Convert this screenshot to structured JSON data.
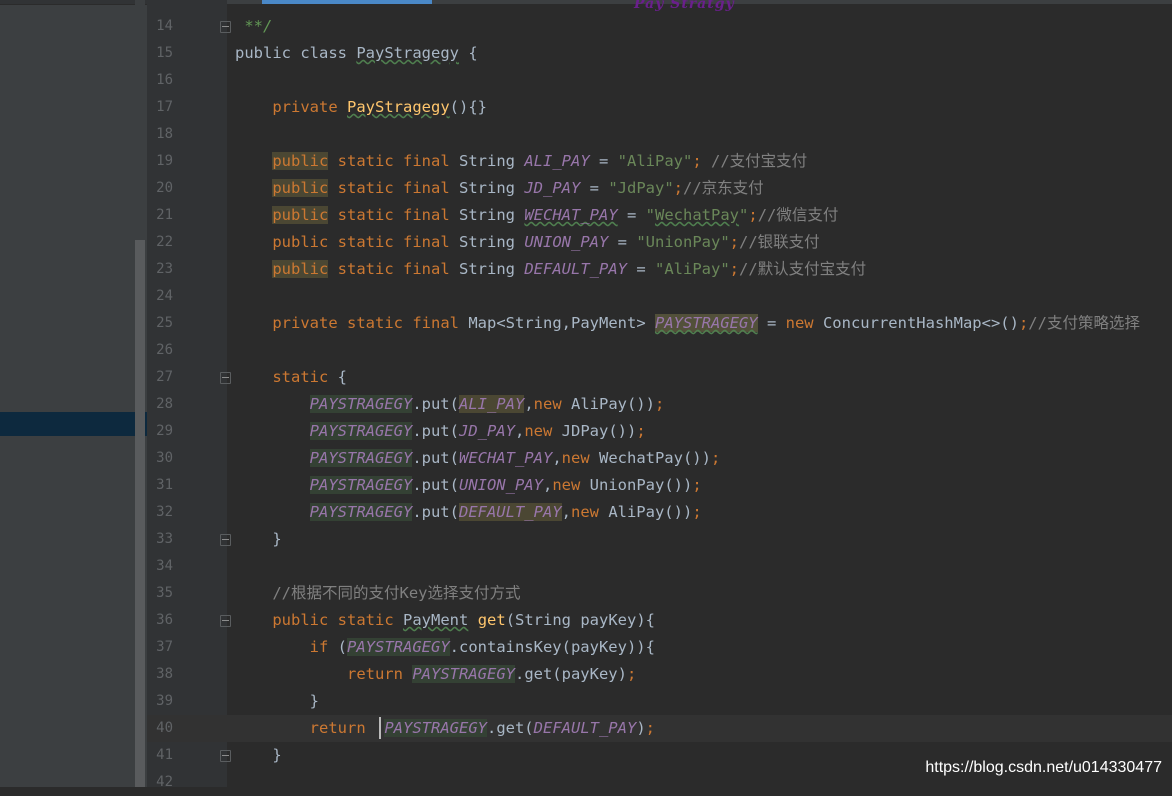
{
  "watermark": "https://blog.csdn.net/u014330477",
  "logo_text": "Pay Stratgy",
  "lines": [
    {
      "num": "14",
      "fold": true,
      "html": "<span class=\"doc\"> **/</span>"
    },
    {
      "num": "15",
      "html": "public class <span class=\"wv\">PayStragegy</span> {"
    },
    {
      "num": "16",
      "html": ""
    },
    {
      "num": "17",
      "html": "    <span class=\"kw\">private</span> <span class=\"fn wv\">PayStragegy</span>(){}"
    },
    {
      "num": "18",
      "html": ""
    },
    {
      "num": "19",
      "html": "    <span class=\"kw hl\">public</span> <span class=\"kw\">static</span> <span class=\"kw\">final</span> String <span class=\"cst\">ALI_PAY</span> = <span class=\"st\">\"AliPay\"</span><span class=\"kw\">;</span> <span class=\"cm\">//支付宝支付</span>"
    },
    {
      "num": "20",
      "html": "    <span class=\"kw hl\">public</span> <span class=\"kw\">static</span> <span class=\"kw\">final</span> String <span class=\"cst\">JD_PAY</span> = <span class=\"st\">\"JdPay\"</span><span class=\"kw\">;</span><span class=\"cm\">//京东支付</span>"
    },
    {
      "num": "21",
      "html": "    <span class=\"kw hl\">public</span> <span class=\"kw\">static</span> <span class=\"kw\">final</span> String <span class=\"cst wv\">WECHAT_PAY</span> = <span class=\"st\">\"<span class=\"wv\">WechatPay</span>\"</span><span class=\"kw\">;</span><span class=\"cm\">//微信支付</span>"
    },
    {
      "num": "22",
      "html": "    <span class=\"kw\">public</span> <span class=\"kw\">static</span> <span class=\"kw\">final</span> String <span class=\"cst\">UNION_PAY</span> = <span class=\"st\">\"UnionPay\"</span><span class=\"kw\">;</span><span class=\"cm\">//银联支付</span>"
    },
    {
      "num": "23",
      "html": "    <span class=\"kw hl\">public</span> <span class=\"kw\">static</span> <span class=\"kw\">final</span> String <span class=\"cst\">DEFAULT_PAY</span> = <span class=\"st\">\"AliPay\"</span><span class=\"kw\">;</span><span class=\"cm\">//默认支付宝支付</span>"
    },
    {
      "num": "24",
      "html": ""
    },
    {
      "num": "25",
      "html": "    <span class=\"kw\">private</span> <span class=\"kw\">static</span> <span class=\"kw\">final</span> Map&lt;String,PayMent&gt; <span class=\"cst hr wv\">PAYSTRAGEGY</span> = <span class=\"kw\">new</span> ConcurrentHashMap&lt;&gt;()<span class=\"kw\">;</span><span class=\"cm\">//支付策略选择</span>"
    },
    {
      "num": "26",
      "html": ""
    },
    {
      "num": "27",
      "fold": true,
      "html": "    <span class=\"kw\">static</span> {"
    },
    {
      "num": "28",
      "html": "        <span class=\"cst hg\">PAYSTRAGEGY</span>.put(<span class=\"cst hl\">ALI_PAY</span>,<span class=\"kw\">new</span> AliPay())<span class=\"kw\">;</span>"
    },
    {
      "num": "29",
      "html": "        <span class=\"cst hg\">PAYSTRAGEGY</span>.put(<span class=\"cst\">JD_PAY</span>,<span class=\"kw\">new</span> JDPay())<span class=\"kw\">;</span>"
    },
    {
      "num": "30",
      "html": "        <span class=\"cst hg\">PAYSTRAGEGY</span>.put(<span class=\"cst\">WECHAT_PAY</span>,<span class=\"kw\">new</span> WechatPay())<span class=\"kw\">;</span>"
    },
    {
      "num": "31",
      "html": "        <span class=\"cst hg\">PAYSTRAGEGY</span>.put(<span class=\"cst\">UNION_PAY</span>,<span class=\"kw\">new</span> UnionPay())<span class=\"kw\">;</span>"
    },
    {
      "num": "32",
      "html": "        <span class=\"cst hg\">PAYSTRAGEGY</span>.put(<span class=\"cst hl\">DEFAULT_PAY</span>,<span class=\"kw\">new</span> AliPay())<span class=\"kw\">;</span>"
    },
    {
      "num": "33",
      "fold": true,
      "html": "    }"
    },
    {
      "num": "34",
      "html": ""
    },
    {
      "num": "35",
      "html": "    <span class=\"cm\">//根据不同的支付Key选择支付方式</span>"
    },
    {
      "num": "36",
      "fold": true,
      "html": "    <span class=\"kw\">public</span> <span class=\"kw\">static</span> <span class=\"wv\">PayMent</span> <span class=\"fn\">get</span>(String payKey){"
    },
    {
      "num": "37",
      "html": "        <span class=\"kw\">if</span> (<span class=\"cst hg\">PAYSTRAGEGY</span>.containsKey(payKey)){"
    },
    {
      "num": "38",
      "html": "            <span class=\"kw\">return</span> <span class=\"cst hg\">PAYSTRAGEGY</span>.get(payKey)<span class=\"kw\">;</span>"
    },
    {
      "num": "39",
      "html": "        }"
    },
    {
      "num": "40",
      "cur": true,
      "html": "        <span class=\"kw\">return</span>  <span class=\"cst hg\">PAYSTRAGEGY</span>.get(<span class=\"cst\">DEFAULT_PAY</span>)<span class=\"kw\">;</span>"
    },
    {
      "num": "41",
      "fold": true,
      "html": "    }"
    },
    {
      "num": "42",
      "html": ""
    }
  ]
}
